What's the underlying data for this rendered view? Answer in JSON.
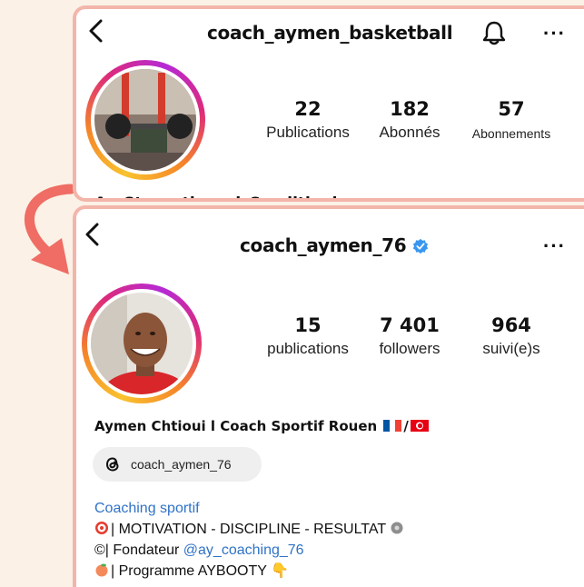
{
  "colors": {
    "background": "#fbf1e6",
    "card_border": "#f3b5aa",
    "link": "#2f73c6",
    "verified": "#3897f0",
    "arrow": "#ef6d64"
  },
  "profile_old": {
    "username": "coach_aymen_basketball",
    "stats": [
      {
        "value": "22",
        "label": "Publications"
      },
      {
        "value": "182",
        "label": "Abonnés"
      },
      {
        "value": "57",
        "label": "Abonnements"
      }
    ],
    "bio_partial": "Ay_Strength_and_Conditioning"
  },
  "profile_new": {
    "username": "coach_aymen_76",
    "stats": [
      {
        "value": "15",
        "label": "publications"
      },
      {
        "value": "7 401",
        "label": "followers"
      },
      {
        "value": "964",
        "label": "suivi(e)s"
      }
    ],
    "display_name": "Aymen Chtioui l Coach Sportif Rouen",
    "threads_handle": "coach_aymen_76",
    "bio": {
      "category": "Coaching sportif",
      "line1": "| MOTIVATION - DISCIPLINE - RESULTAT",
      "line2_prefix": "| Fondateur ",
      "line2_mention": "@ay_coaching_76",
      "line3": "| Programme AYBOOTY"
    }
  },
  "icons": [
    "back-arrow-icon",
    "bell-icon",
    "more-options-icon",
    "verified-badge-icon",
    "threads-icon",
    "curved-arrow-icon"
  ]
}
